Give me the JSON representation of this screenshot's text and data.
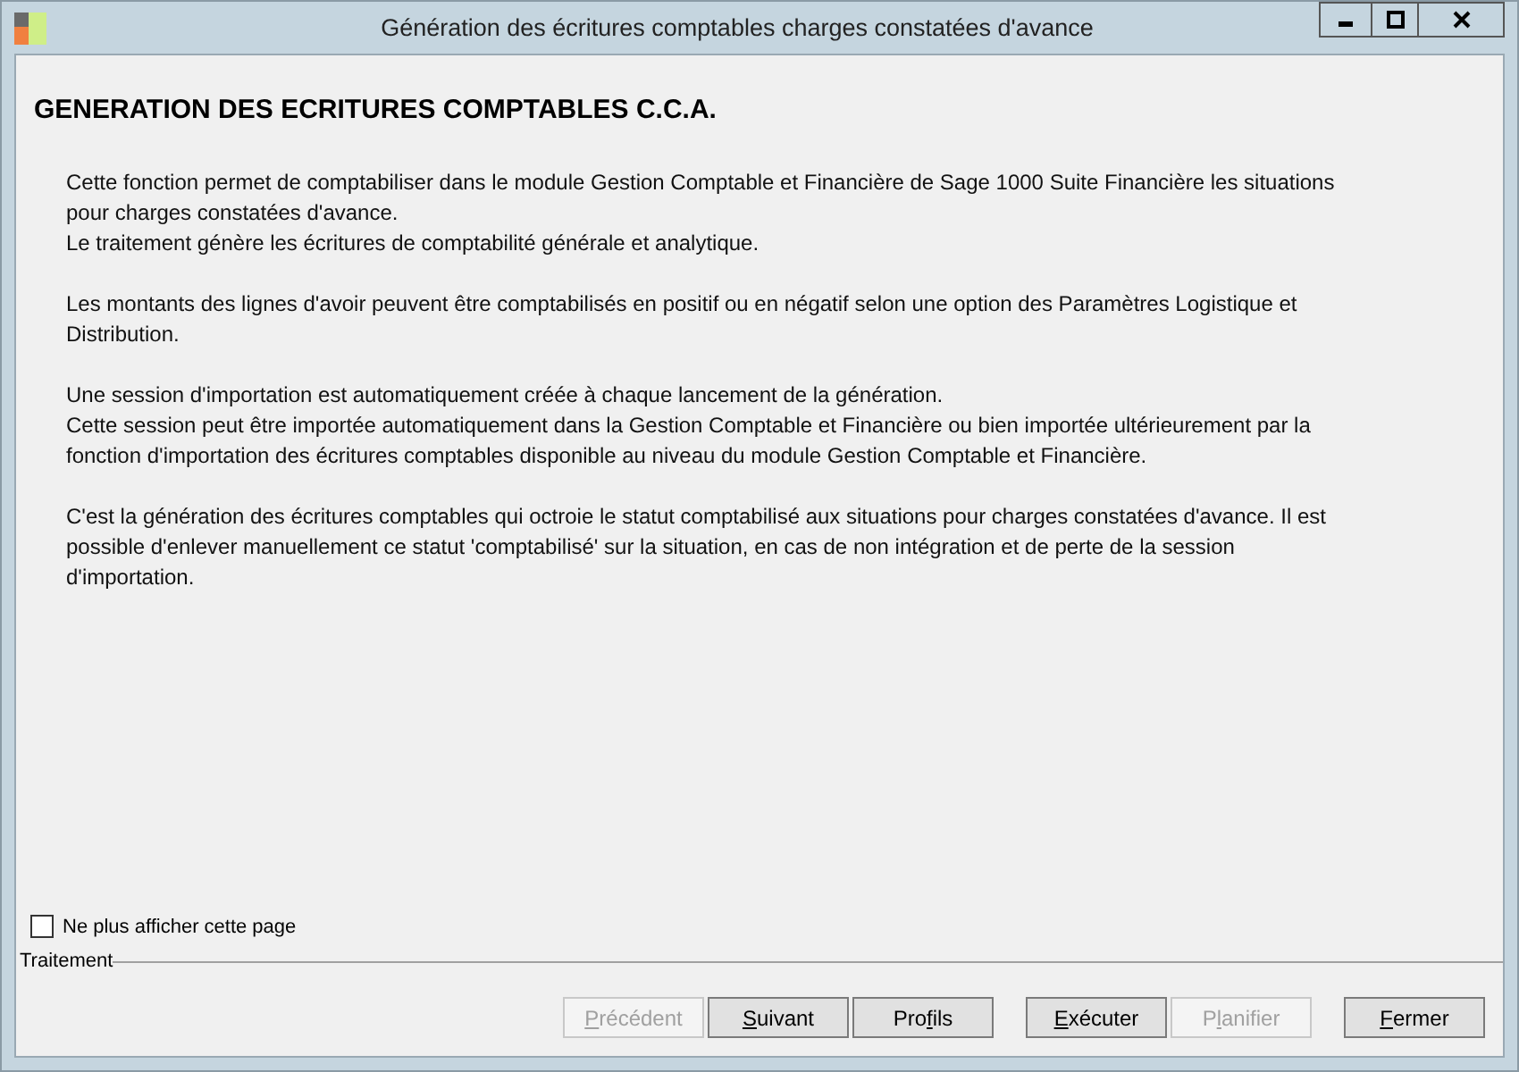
{
  "window": {
    "title": "Génération des écritures comptables charges constatées d'avance"
  },
  "heading": "GENERATION DES ECRITURES COMPTABLES C.C.A.",
  "paragraphs": [
    [
      "Cette fonction permet de comptabiliser dans le module Gestion Comptable et Financière de Sage 1000 Suite Financière les situations",
      "pour charges constatées d'avance.",
      "Le traitement génère les écritures de comptabilité générale et analytique."
    ],
    [
      "Les montants des lignes d'avoir peuvent être comptabilisés en positif ou en négatif selon une option des Paramètres Logistique et",
      "Distribution."
    ],
    [
      "Une session d'importation est automatiquement créée à chaque lancement de la génération.",
      "Cette session peut être importée automatiquement dans la Gestion Comptable et Financière ou bien importée ultérieurement par la",
      "fonction d'importation des écritures comptables disponible au niveau du module Gestion Comptable et Financière."
    ],
    [
      "C'est la génération des écritures comptables qui octroie le statut comptabilisé aux situations pour charges constatées d'avance. Il est",
      "possible d'enlever manuellement ce statut 'comptabilisé' sur la situation, en cas de non intégration et de perte de la session",
      "d'importation."
    ]
  ],
  "dont_show_again": {
    "label": "Ne plus afficher cette page",
    "checked": false
  },
  "group_label": "Traitement",
  "button_groups": [
    [
      {
        "key": "P",
        "after": "récédent",
        "disabled": true
      },
      {
        "key": "S",
        "after": "uivant",
        "disabled": false
      },
      {
        "before": "Pro",
        "key": "f",
        "after": "ils",
        "disabled": false
      }
    ],
    [
      {
        "key": "E",
        "after": "xécuter",
        "disabled": false
      },
      {
        "before": "P",
        "key": "l",
        "after": "anifier",
        "disabled": true
      }
    ],
    [
      {
        "key": "F",
        "after": "ermer",
        "disabled": false
      }
    ]
  ]
}
